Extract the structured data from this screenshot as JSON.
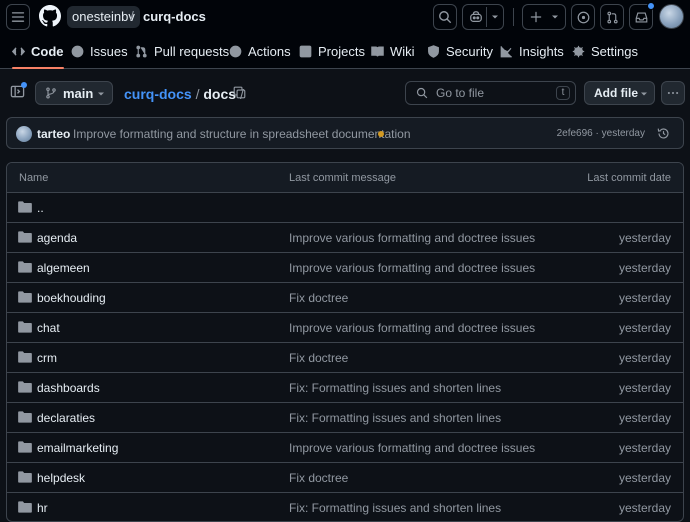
{
  "header": {
    "owner": "onesteinbv",
    "separator": "/",
    "repo": "curq-docs"
  },
  "nav": {
    "tabs": [
      {
        "label": "Code",
        "icon": "code-icon"
      },
      {
        "label": "Issues",
        "icon": "issue-opened-icon"
      },
      {
        "label": "Pull requests",
        "icon": "git-pull-request-icon"
      },
      {
        "label": "Actions",
        "icon": "play-icon"
      },
      {
        "label": "Projects",
        "icon": "table-icon"
      },
      {
        "label": "Wiki",
        "icon": "book-icon"
      },
      {
        "label": "Security",
        "icon": "shield-icon"
      },
      {
        "label": "Insights",
        "icon": "graph-icon"
      },
      {
        "label": "Settings",
        "icon": "gear-icon"
      }
    ]
  },
  "filebar": {
    "branch": "main",
    "path_repo": "curq-docs",
    "path_sep": "/",
    "path_dir": "docs",
    "path_trail": "/",
    "go_to_file_placeholder": "Go to file",
    "go_to_file_key": "t",
    "add_file_label": "Add file"
  },
  "commit": {
    "author": "tarteo",
    "message": "Improve formatting and structure in spreadsheet documentation",
    "sha": "2efe696",
    "dot": "·",
    "time": "yesterday",
    "status_color": "#d29922"
  },
  "table": {
    "headers": {
      "name": "Name",
      "message": "Last commit message",
      "date": "Last commit date"
    },
    "parent": "..",
    "rows": [
      {
        "name": "agenda",
        "message": "Improve various formatting and doctree issues",
        "date": "yesterday"
      },
      {
        "name": "algemeen",
        "message": "Improve various formatting and doctree issues",
        "date": "yesterday"
      },
      {
        "name": "boekhouding",
        "message": "Fix doctree",
        "date": "yesterday"
      },
      {
        "name": "chat",
        "message": "Improve various formatting and doctree issues",
        "date": "yesterday"
      },
      {
        "name": "crm",
        "message": "Fix doctree",
        "date": "yesterday"
      },
      {
        "name": "dashboards",
        "message": "Fix: Formatting issues and shorten lines",
        "date": "yesterday"
      },
      {
        "name": "declaraties",
        "message": "Fix: Formatting issues and shorten lines",
        "date": "yesterday"
      },
      {
        "name": "emailmarketing",
        "message": "Improve various formatting and doctree issues",
        "date": "yesterday"
      },
      {
        "name": "helpdesk",
        "message": "Fix doctree",
        "date": "yesterday"
      },
      {
        "name": "hr",
        "message": "Fix: Formatting issues and shorten lines",
        "date": "yesterday"
      }
    ]
  },
  "colors": {
    "background": "#0d1117",
    "accent_underline": "#f78166",
    "link": "#4493f8",
    "notification": "#4493f8"
  }
}
